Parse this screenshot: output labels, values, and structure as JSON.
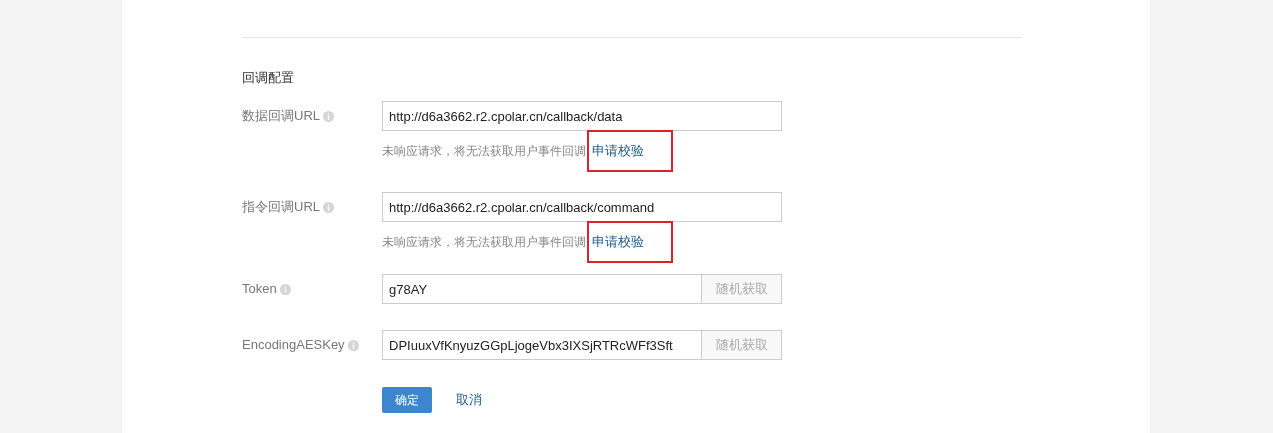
{
  "section_title": "回调配置",
  "url_fields": [
    {
      "label": "数据回调URL",
      "value": "http://d6a3662.r2.cpolar.cn/callback/data",
      "hint": "未响应请求，将无法获取用户事件回调",
      "link": "申请校验",
      "highlighted": true
    },
    {
      "label": "指令回调URL",
      "value": "http://d6a3662.r2.cpolar.cn/callback/command",
      "hint": "未响应请求，将无法获取用户事件回调",
      "link": "申请校验",
      "highlighted": true
    }
  ],
  "key_fields": [
    {
      "label": "Token",
      "value": "g78AY",
      "button": "随机获取"
    },
    {
      "label": "EncodingAESKey",
      "value": "DPIuuxVfKnyuzGGpLjogeVbx3IXSjRTRcWFf3Sft",
      "button": "随机获取"
    }
  ],
  "actions": {
    "confirm": "确定",
    "cancel": "取消"
  }
}
